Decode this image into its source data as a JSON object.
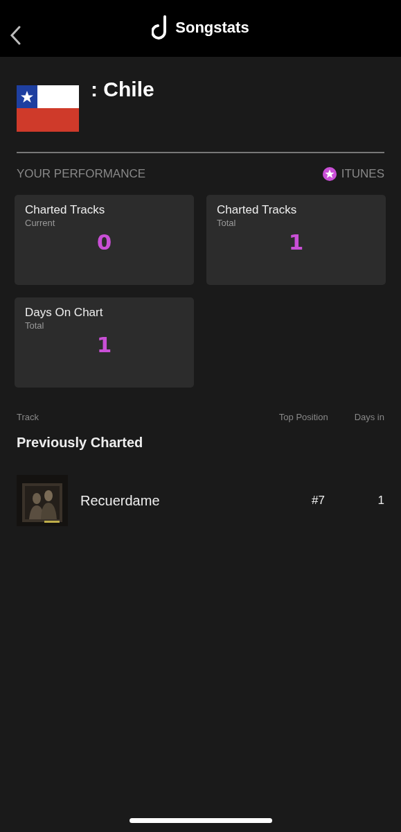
{
  "header": {
    "title": "Songstats"
  },
  "country": {
    "name": ": Chile"
  },
  "performance": {
    "label": "YOUR PERFORMANCE",
    "source": "ITUNES"
  },
  "stats": [
    {
      "title": "Charted Tracks",
      "subtitle": "Current",
      "value": "0"
    },
    {
      "title": "Charted Tracks",
      "subtitle": "Total",
      "value": "1"
    },
    {
      "title": "Days On Chart",
      "subtitle": "Total",
      "value": "1"
    }
  ],
  "table": {
    "columns": [
      "Track",
      "Top Position",
      "Days in"
    ],
    "section": "Previously Charted",
    "rows": [
      {
        "track": "Recuerdame",
        "top_position": "#7",
        "days_in": "1"
      }
    ]
  }
}
